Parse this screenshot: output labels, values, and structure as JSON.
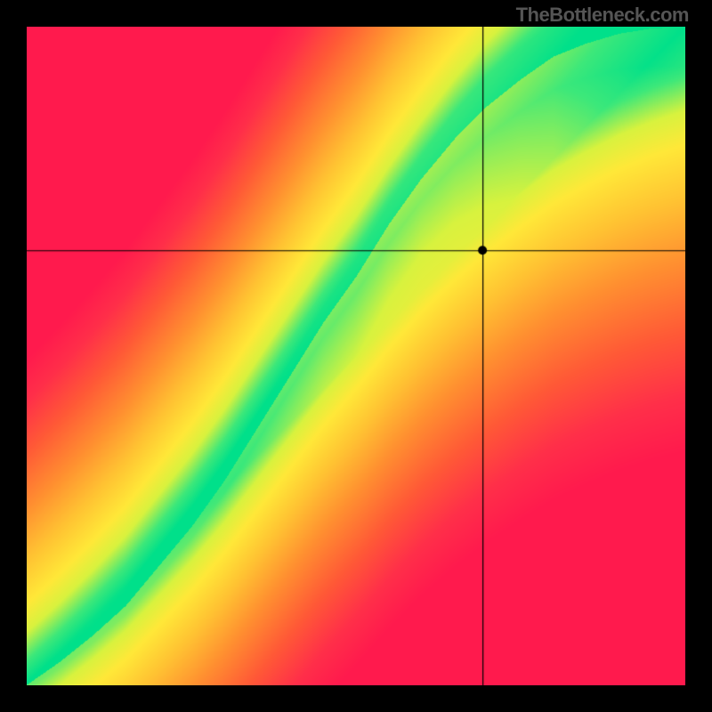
{
  "watermark": "TheBottleneck.com",
  "chart_data": {
    "type": "heatmap",
    "title": "",
    "xlabel": "",
    "ylabel": "",
    "xlim": [
      0,
      1
    ],
    "ylim": [
      0,
      1
    ],
    "crosshair": {
      "x": 0.693,
      "y": 0.66
    },
    "marker": {
      "x": 0.693,
      "y": 0.66,
      "radius": 5,
      "fill": "#000000"
    },
    "ridge_curve": {
      "description": "Locus of optimal (green) match; monotone increasing, slope > 1 overall",
      "points": [
        {
          "x": 0.0,
          "y": 0.0
        },
        {
          "x": 0.05,
          "y": 0.035
        },
        {
          "x": 0.1,
          "y": 0.075
        },
        {
          "x": 0.15,
          "y": 0.12
        },
        {
          "x": 0.2,
          "y": 0.18
        },
        {
          "x": 0.25,
          "y": 0.24
        },
        {
          "x": 0.3,
          "y": 0.31
        },
        {
          "x": 0.35,
          "y": 0.39
        },
        {
          "x": 0.4,
          "y": 0.47
        },
        {
          "x": 0.45,
          "y": 0.55
        },
        {
          "x": 0.5,
          "y": 0.62
        },
        {
          "x": 0.55,
          "y": 0.7
        },
        {
          "x": 0.6,
          "y": 0.77
        },
        {
          "x": 0.65,
          "y": 0.83
        },
        {
          "x": 0.7,
          "y": 0.88
        },
        {
          "x": 0.75,
          "y": 0.92
        },
        {
          "x": 0.8,
          "y": 0.955
        },
        {
          "x": 0.85,
          "y": 0.975
        },
        {
          "x": 0.9,
          "y": 0.99
        },
        {
          "x": 0.95,
          "y": 0.998
        },
        {
          "x": 1.0,
          "y": 1.0
        }
      ]
    },
    "ridge_width": {
      "description": "Approx. half-width (in y-units) of green band at each x",
      "points": [
        {
          "x": 0.0,
          "y": 0.01
        },
        {
          "x": 0.1,
          "y": 0.018
        },
        {
          "x": 0.2,
          "y": 0.025
        },
        {
          "x": 0.3,
          "y": 0.03
        },
        {
          "x": 0.4,
          "y": 0.035
        },
        {
          "x": 0.5,
          "y": 0.042
        },
        {
          "x": 0.6,
          "y": 0.055
        },
        {
          "x": 0.7,
          "y": 0.075
        },
        {
          "x": 0.8,
          "y": 0.085
        },
        {
          "x": 0.9,
          "y": 0.09
        },
        {
          "x": 1.0,
          "y": 0.1
        }
      ]
    },
    "color_scale": {
      "description": "Distance from ridge maps to color gradient",
      "stops": [
        {
          "t": 0.0,
          "color": "#00e08a"
        },
        {
          "t": 0.06,
          "color": "#3de87a"
        },
        {
          "t": 0.14,
          "color": "#d8f23e"
        },
        {
          "t": 0.22,
          "color": "#ffe838"
        },
        {
          "t": 0.35,
          "color": "#ffc232"
        },
        {
          "t": 0.5,
          "color": "#ff9030"
        },
        {
          "t": 0.68,
          "color": "#ff5a36"
        },
        {
          "t": 0.85,
          "color": "#ff2f49"
        },
        {
          "t": 1.0,
          "color": "#ff1a4d"
        }
      ]
    },
    "corner_colors_observed": {
      "top_left": "#ff1a4d",
      "top_right": "#ffe83a",
      "bottom_left": "#ff6a2f",
      "bottom_right": "#ff1a4d"
    }
  }
}
